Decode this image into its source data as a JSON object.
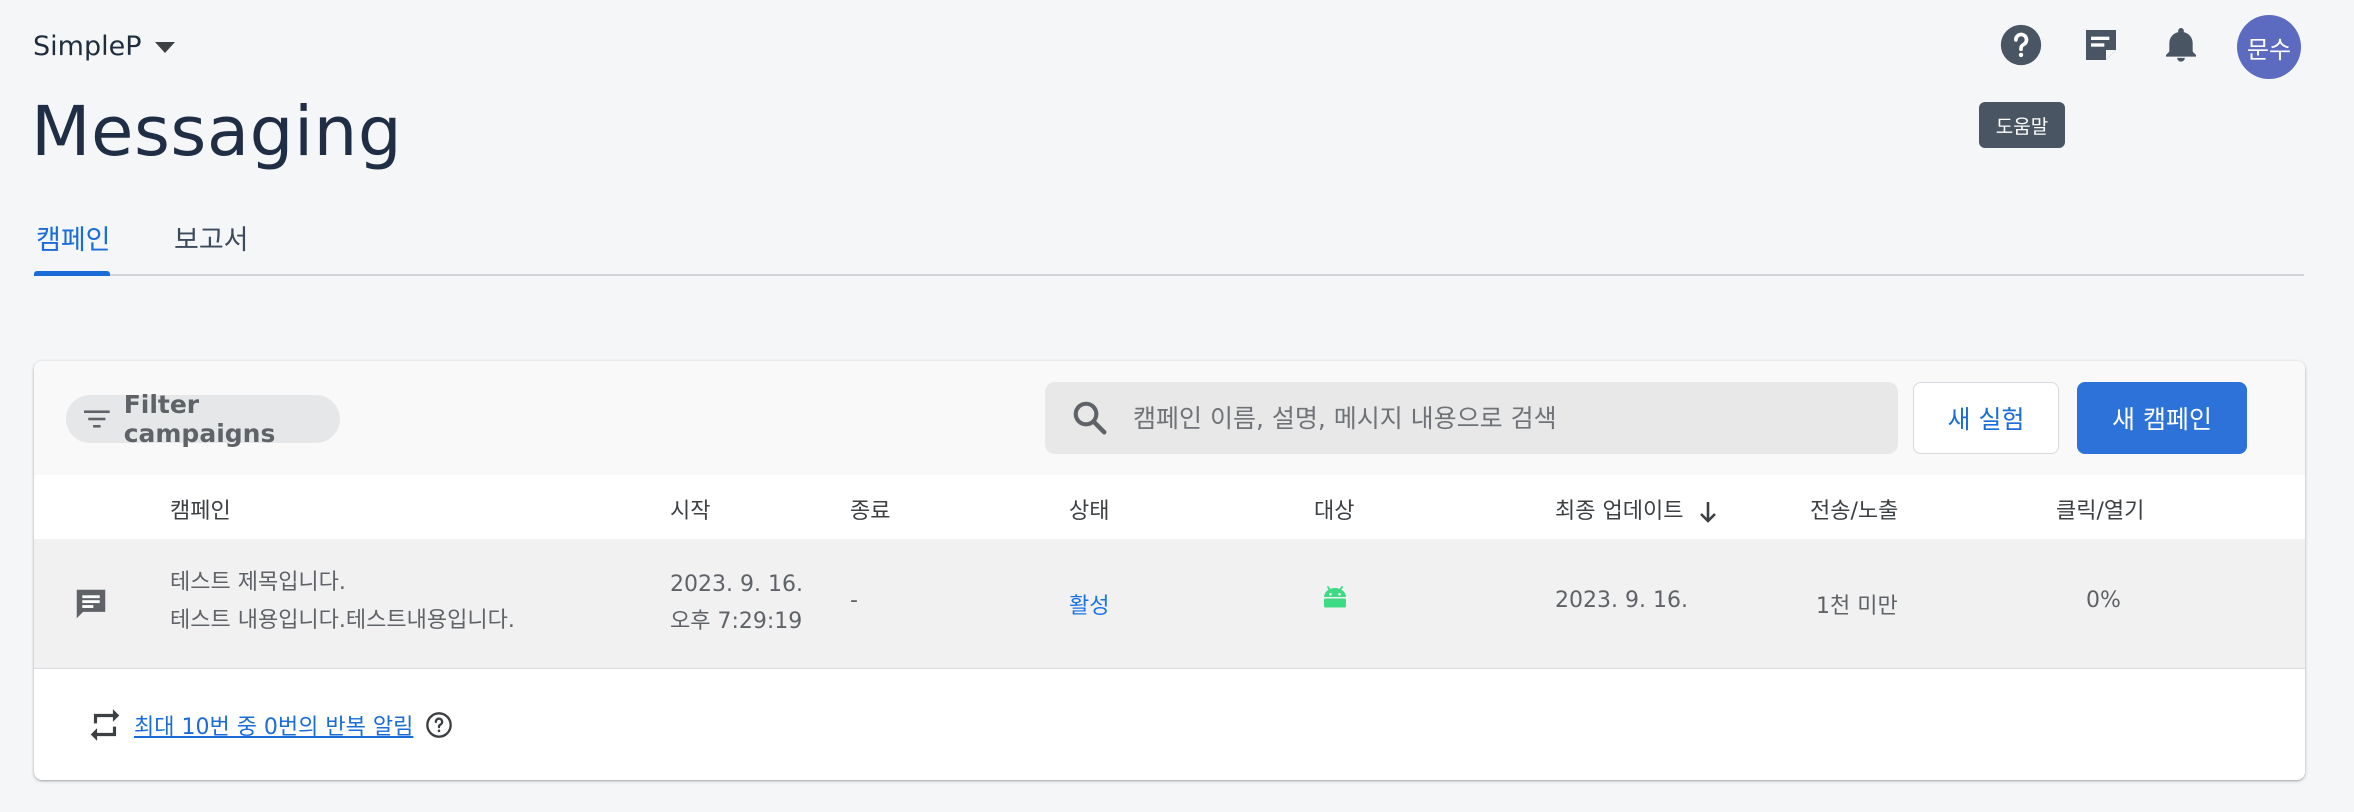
{
  "project": {
    "name": "SimpleP"
  },
  "header": {
    "avatar_text": "문수",
    "tooltip": "도움말"
  },
  "page": {
    "title": "Messaging"
  },
  "tabs": [
    {
      "label": "캠페인",
      "active": true
    },
    {
      "label": "보고서",
      "active": false
    }
  ],
  "toolbar": {
    "filter_label": "Filter campaigns",
    "search_placeholder": "캠페인 이름, 설명, 메시지 내용으로 검색",
    "new_experiment_label": "새 실험",
    "new_campaign_label": "새 캠페인"
  },
  "table": {
    "headers": {
      "campaign": "캠페인",
      "start": "시작",
      "end": "종료",
      "status": "상태",
      "target": "대상",
      "last_updated": "최종 업데이트",
      "sends": "전송/노출",
      "clicks": "클릭/열기"
    },
    "rows": [
      {
        "title": "테스트 제목입니다.",
        "body": "테스트 내용입니다.테스트내용입니다.",
        "start_date": "2023. 9. 16.",
        "start_time": "오후 7:29:19",
        "end": "-",
        "status": "활성",
        "target_icon": "android-icon",
        "last_updated": "2023. 9. 16.",
        "sends": "1천 미만",
        "clicks": "0%"
      }
    ]
  },
  "footer": {
    "repeat_text": "최대 10번 중 0번의 반복 알림"
  },
  "colors": {
    "accent": "#1a6cd8",
    "primary_button": "#2d72d9",
    "avatar": "#5c6bc0",
    "android": "#3ddc84"
  }
}
